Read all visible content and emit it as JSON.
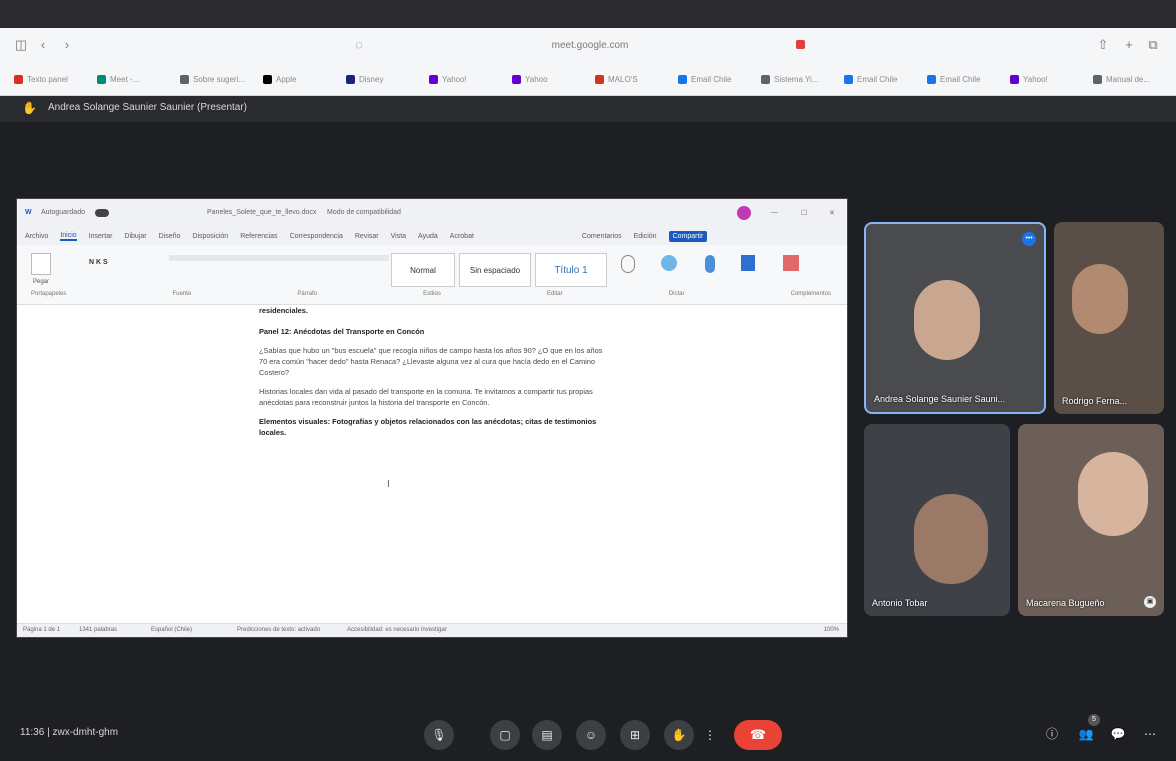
{
  "browser": {
    "url": "meet.google.com",
    "bookmarks": [
      {
        "label": "Texto panel",
        "color": "#d93025"
      },
      {
        "label": "Meet -...",
        "color": "#00897b"
      },
      {
        "label": "Sobre sugeri...",
        "color": "#5f6368"
      },
      {
        "label": "Apple",
        "color": "#000000"
      },
      {
        "label": "Disney",
        "color": "#1a237e"
      },
      {
        "label": "Yahoo!",
        "color": "#6001d2"
      },
      {
        "label": "Yahoo",
        "color": "#6001d2"
      },
      {
        "label": "MALO'S",
        "color": "#d93025"
      },
      {
        "label": "Email Chile",
        "color": "#1a73e8"
      },
      {
        "label": "Sistema Yi...",
        "color": "#5f6368"
      },
      {
        "label": "Email Chile",
        "color": "#1a73e8"
      },
      {
        "label": "Email Chile",
        "color": "#1a73e8"
      },
      {
        "label": "Yahoo!",
        "color": "#6001d2"
      },
      {
        "label": "Manual de...",
        "color": "#5f6368"
      }
    ]
  },
  "meet": {
    "presenter": "Andrea Solange Saunier Saunier (Presentar)",
    "time": "11:36",
    "code": "zwx-dmht-ghm",
    "people_count": "5"
  },
  "word": {
    "autosave": "Autoguardado",
    "filename": "Paneles_Solete_que_te_llevo.docx",
    "mode": "Modo de compatibilidad",
    "tabs": [
      "Archivo",
      "Inicio",
      "Insertar",
      "Dibujar",
      "Diseño",
      "Disposición",
      "Referencias",
      "Correspondencia",
      "Revisar",
      "Vista",
      "Ayuda",
      "Acrobat"
    ],
    "active_tab": "Inicio",
    "comments_btn": "Comentarios",
    "edit_btn": "Edición",
    "share_btn": "Compartir",
    "styles": [
      "Normal",
      "Sin espaciado",
      "Título 1"
    ],
    "paste_label": "Pegar",
    "ribbon_labels": [
      "Portapapeles",
      "Fuente",
      "Párrafo",
      "Estilos",
      "Editar",
      "Dictar",
      "Complementos"
    ],
    "doc": {
      "fragment": "residenciales.",
      "heading": "Panel 12: Anécdotas del Transporte en Concón",
      "para1": "¿Sabías que hubo un \"bus escuela\" que recogía niños de campo hasta los años 90? ¿O que en los años 70 era común \"hacer dedo\" hasta Renaca? ¿Llevaste alguna vez al cura que hacía dedo en el Camino Costero?",
      "para2": "Historias locales dan vida al pasado del transporte en la comuna. Te invitamos a compartir tus propias anécdotas para reconstruir juntos la historia del transporte en Concón.",
      "para3": "Elementos visuales: Fotografías y objetos relacionados con las anécdotas; citas de testimonios locales."
    },
    "status": {
      "page": "Página 1 de 1",
      "words": "1341 palabras",
      "lang": "Español (Chile)",
      "predictions": "Predicciones de texto: activado",
      "accessibility": "Accesibilidad: es necesario investigar",
      "zoom": "100%"
    }
  },
  "participants": [
    {
      "name": "Andrea Solange Saunier Sauni...",
      "bg": "#4a4b4f"
    },
    {
      "name": "Rodrigo Ferna...",
      "bg": "#5a4f46"
    },
    {
      "name": "Antonio Tobar",
      "bg": "#3e4147"
    },
    {
      "name": "Macarena Bugueño",
      "bg": "#6b5f57"
    }
  ]
}
